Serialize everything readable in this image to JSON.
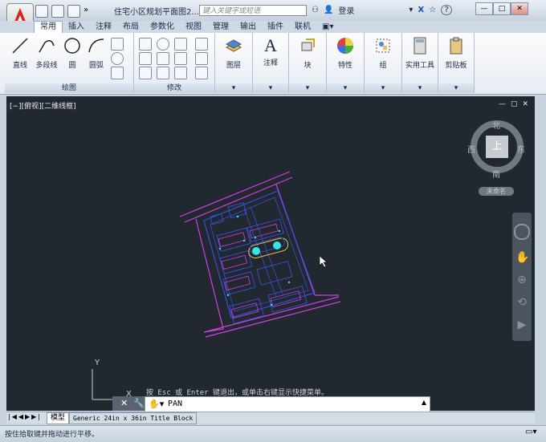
{
  "titlebar": {
    "document_title": "住宅小区规划平面图2....",
    "search_placeholder": "键入关键字或短语",
    "login_label": "登录",
    "help_label": "?"
  },
  "tabs": [
    {
      "label": "常用",
      "active": true
    },
    {
      "label": "插入"
    },
    {
      "label": "注释"
    },
    {
      "label": "布局"
    },
    {
      "label": "参数化"
    },
    {
      "label": "视图"
    },
    {
      "label": "管理"
    },
    {
      "label": "输出"
    },
    {
      "label": "插件"
    },
    {
      "label": "联机"
    }
  ],
  "ribbon": {
    "draw_panel": {
      "title": "绘图",
      "tools": [
        "直线",
        "多段线",
        "圆",
        "圆弧"
      ]
    },
    "modify_panel": {
      "title": "修改"
    },
    "big_tools": [
      "图层",
      "注释",
      "块",
      "特性",
      "组",
      "实用工具",
      "剪贴板"
    ]
  },
  "viewport": {
    "label": "[−][俯视][二维线框]",
    "compass": {
      "north": "北",
      "south": "南",
      "east": "东",
      "west": "西",
      "center": "上"
    },
    "wcs_label": "未命名",
    "ucs_y": "Y",
    "ucs_x": "X"
  },
  "command": {
    "hint": "按 Esc 或 Enter 键退出，或单击右键显示快捷菜单。",
    "value": "PAN"
  },
  "layout_tabs": [
    "模型",
    "Generic 24in x 36in Title Block"
  ],
  "status_text": "按住拾取键并拖动进行平移。",
  "colors": {
    "canvas": "#212830",
    "magenta": "#d040e0",
    "blue": "#3b4fd6",
    "cyan": "#35e6e6",
    "yellow": "#e6c44a"
  }
}
